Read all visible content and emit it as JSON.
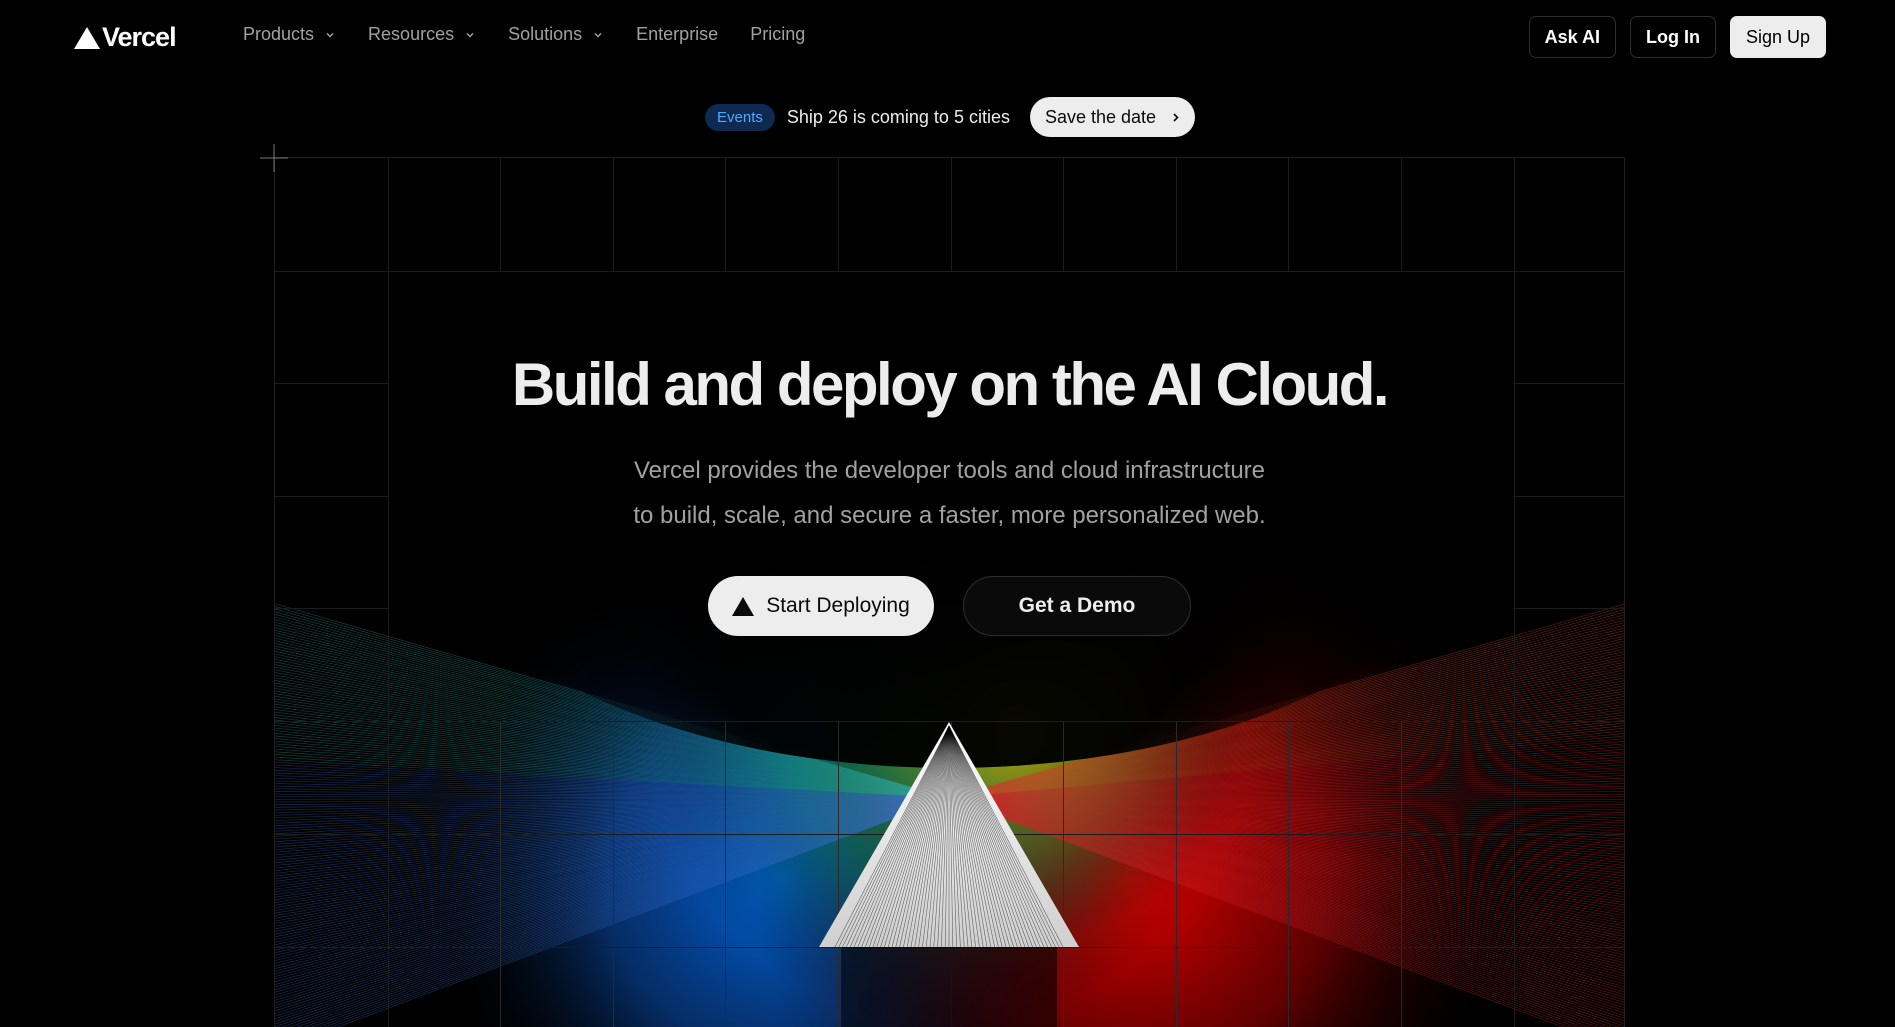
{
  "nav": {
    "brand": "Vercel",
    "links": [
      {
        "label": "Products",
        "dropdown": true
      },
      {
        "label": "Resources",
        "dropdown": true
      },
      {
        "label": "Solutions",
        "dropdown": true
      },
      {
        "label": "Enterprise",
        "dropdown": false
      },
      {
        "label": "Pricing",
        "dropdown": false
      }
    ],
    "ask_ai": "Ask AI",
    "log_in": "Log In",
    "sign_up": "Sign Up"
  },
  "banner": {
    "badge": "Events",
    "text": "Ship 26 is coming to 5 cities",
    "cta": "Save the date"
  },
  "hero": {
    "title": "Build and deploy on the AI Cloud.",
    "subtitle_line1": "Vercel provides the developer tools and cloud infrastructure",
    "subtitle_line2": "to build, scale, and secure a faster, more personalized web.",
    "primary_cta": "Start Deploying",
    "secondary_cta": "Get a Demo"
  },
  "icons": {
    "logo": "vercel-triangle-icon",
    "dropdown": "chevron-down-icon",
    "banner_arrow": "chevron-right-icon",
    "cta": "vercel-triangle-icon"
  },
  "colors": {
    "background": "#000000",
    "text": "#ededed",
    "muted": "#a1a1a1",
    "badge_bg": "#0e2a52",
    "badge_text": "#52a8ff",
    "spectrum": [
      "#00a86b",
      "#0061d5",
      "#e5c100",
      "#d90000"
    ]
  }
}
